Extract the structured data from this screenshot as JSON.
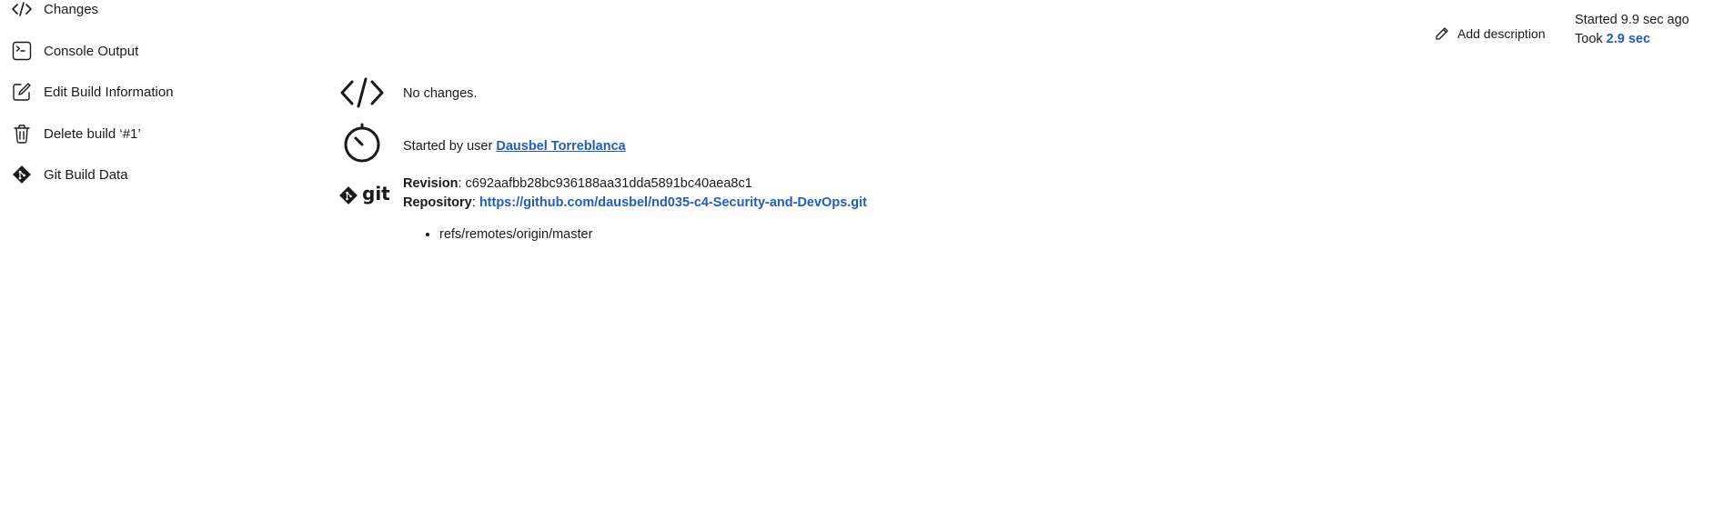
{
  "sidebar": {
    "items": [
      {
        "label": "Changes",
        "icon": "code-icon"
      },
      {
        "label": "Console Output",
        "icon": "terminal-icon"
      },
      {
        "label": "Edit Build Information",
        "icon": "edit-icon"
      },
      {
        "label": "Delete build ‘#1’",
        "icon": "trash-icon"
      },
      {
        "label": "Git Build Data",
        "icon": "git-icon"
      }
    ]
  },
  "header": {
    "add_description_label": "Add description",
    "started_text": "Started 9.9 sec ago",
    "took_prefix": "Took ",
    "took_value": "2.9 sec"
  },
  "main": {
    "changes_text": "No changes.",
    "started_by_prefix": "Started by user ",
    "started_by_user": "Dausbel Torreblanca",
    "git_label": "git",
    "revision_label": "Revision",
    "revision_value": "c692aafbb28bc936188aa31dda5891bc40aea8c1",
    "repository_label": "Repository",
    "repository_url": "https://github.com/dausbel/nd035-c4-Security-and-DevOps.git",
    "refs": [
      "refs/remotes/origin/master"
    ]
  },
  "colors": {
    "link": "#1e5ec4",
    "text": "#1a1a1a",
    "background": "#ffffff"
  }
}
